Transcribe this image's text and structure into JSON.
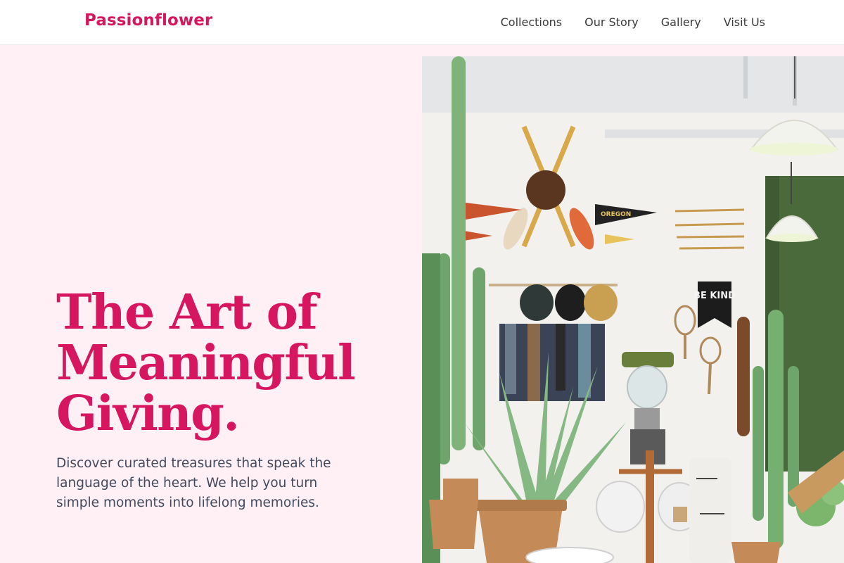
{
  "brand": {
    "name": "Passionflower"
  },
  "nav": {
    "items": [
      "Collections",
      "Our Story",
      "Gallery",
      "Visit Us"
    ]
  },
  "hero": {
    "title": "The Art of Meaningful Giving.",
    "subtitle": "Discover curated treasures that speak the language of the heart. We help you turn simple moments into lifelong memories.",
    "image": {
      "pennant_text_1": "OREGON",
      "banner_text": "BE KIND"
    }
  },
  "colors": {
    "accent": "#d6175f",
    "hero_background": "#fff0f5",
    "header_background": "#ffffff",
    "body_text": "#444a5c"
  }
}
